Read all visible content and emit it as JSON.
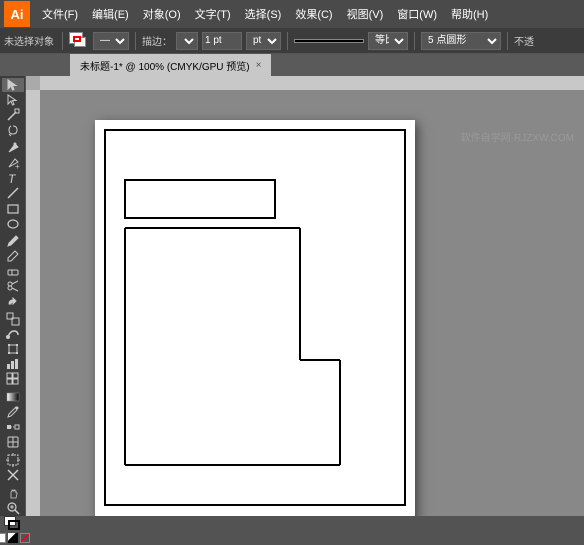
{
  "app": {
    "logo": "Ai",
    "bg_color": "#ff6b00"
  },
  "title_bar": {
    "menus": [
      "文件(F)",
      "编辑(E)",
      "对象(O)",
      "文字(T)",
      "选择(S)",
      "效果(C)",
      "视图(V)",
      "窗口(W)",
      "帮助(H)"
    ]
  },
  "toolbar": {
    "fill_label": "",
    "stroke_label": "",
    "variable_label": "描边：",
    "stroke_size": "1 pt",
    "line_label": "等比",
    "point_label": "5 点圆形",
    "opacity_label": "不透"
  },
  "doc_tab": {
    "title": "未标题-1* @ 100% (CMYK/GPU 预览)",
    "close": "×"
  },
  "watermark": "软件自学网·RJZXW.COM",
  "tools": [
    {
      "name": "select",
      "icon": "V"
    },
    {
      "name": "direct-select",
      "icon": "A"
    },
    {
      "name": "magic-wand",
      "icon": "Y"
    },
    {
      "name": "lasso",
      "icon": "Q"
    },
    {
      "name": "pen",
      "icon": "P"
    },
    {
      "name": "type",
      "icon": "T"
    },
    {
      "name": "line",
      "icon": "\\"
    },
    {
      "name": "rect",
      "icon": "M"
    },
    {
      "name": "paint-brush",
      "icon": "B"
    },
    {
      "name": "pencil",
      "icon": "N"
    },
    {
      "name": "blob-brush",
      "icon": "B"
    },
    {
      "name": "eraser",
      "icon": "E"
    },
    {
      "name": "rotate",
      "icon": "R"
    },
    {
      "name": "reflect",
      "icon": "O"
    },
    {
      "name": "scale",
      "icon": "S"
    },
    {
      "name": "reshape",
      "icon": ""
    },
    {
      "name": "warp",
      "icon": ""
    },
    {
      "name": "free-transform",
      "icon": "E"
    },
    {
      "name": "perspective",
      "icon": ""
    },
    {
      "name": "mesh",
      "icon": "U"
    },
    {
      "name": "gradient",
      "icon": "G"
    },
    {
      "name": "eyedropper",
      "icon": "I"
    },
    {
      "name": "blend",
      "icon": "W"
    },
    {
      "name": "live-paint",
      "icon": "K"
    },
    {
      "name": "artboard",
      "icon": ""
    },
    {
      "name": "slice",
      "icon": ""
    },
    {
      "name": "hand",
      "icon": "H"
    },
    {
      "name": "zoom",
      "icon": "Z"
    }
  ],
  "canvas": {
    "no_selection": "未选择对象"
  }
}
